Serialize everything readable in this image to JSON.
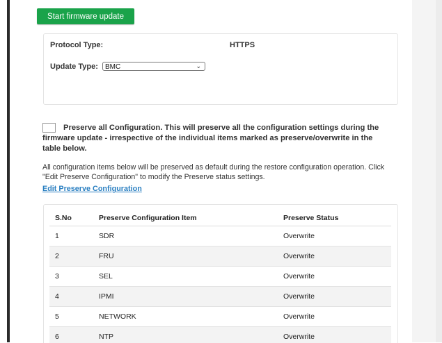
{
  "actions": {
    "start_label": "Start firmware update"
  },
  "protocol": {
    "type_label": "Protocol Type:",
    "type_value": "HTTPS",
    "update_label": "Update Type:",
    "update_value": "BMC"
  },
  "preserve": {
    "all_text": "Preserve all Configuration. This will preserve all the configuration settings during the firmware update - irrespective of the individual items marked as preserve/overwrite in the table below.",
    "checked": false
  },
  "info_text": "All configuration items below will be preserved as default during the restore configuration operation. Click \"Edit Preserve Configuration\" to modify the Preserve status settings.",
  "edit_link": "Edit Preserve Configuration",
  "table": {
    "headers": [
      "S.No",
      "Preserve Configuration Item",
      "Preserve Status"
    ],
    "rows": [
      [
        "1",
        "SDR",
        "Overwrite"
      ],
      [
        "2",
        "FRU",
        "Overwrite"
      ],
      [
        "3",
        "SEL",
        "Overwrite"
      ],
      [
        "4",
        "IPMI",
        "Overwrite"
      ],
      [
        "5",
        "NETWORK",
        "Overwrite"
      ],
      [
        "6",
        "NTP",
        "Overwrite"
      ]
    ]
  }
}
